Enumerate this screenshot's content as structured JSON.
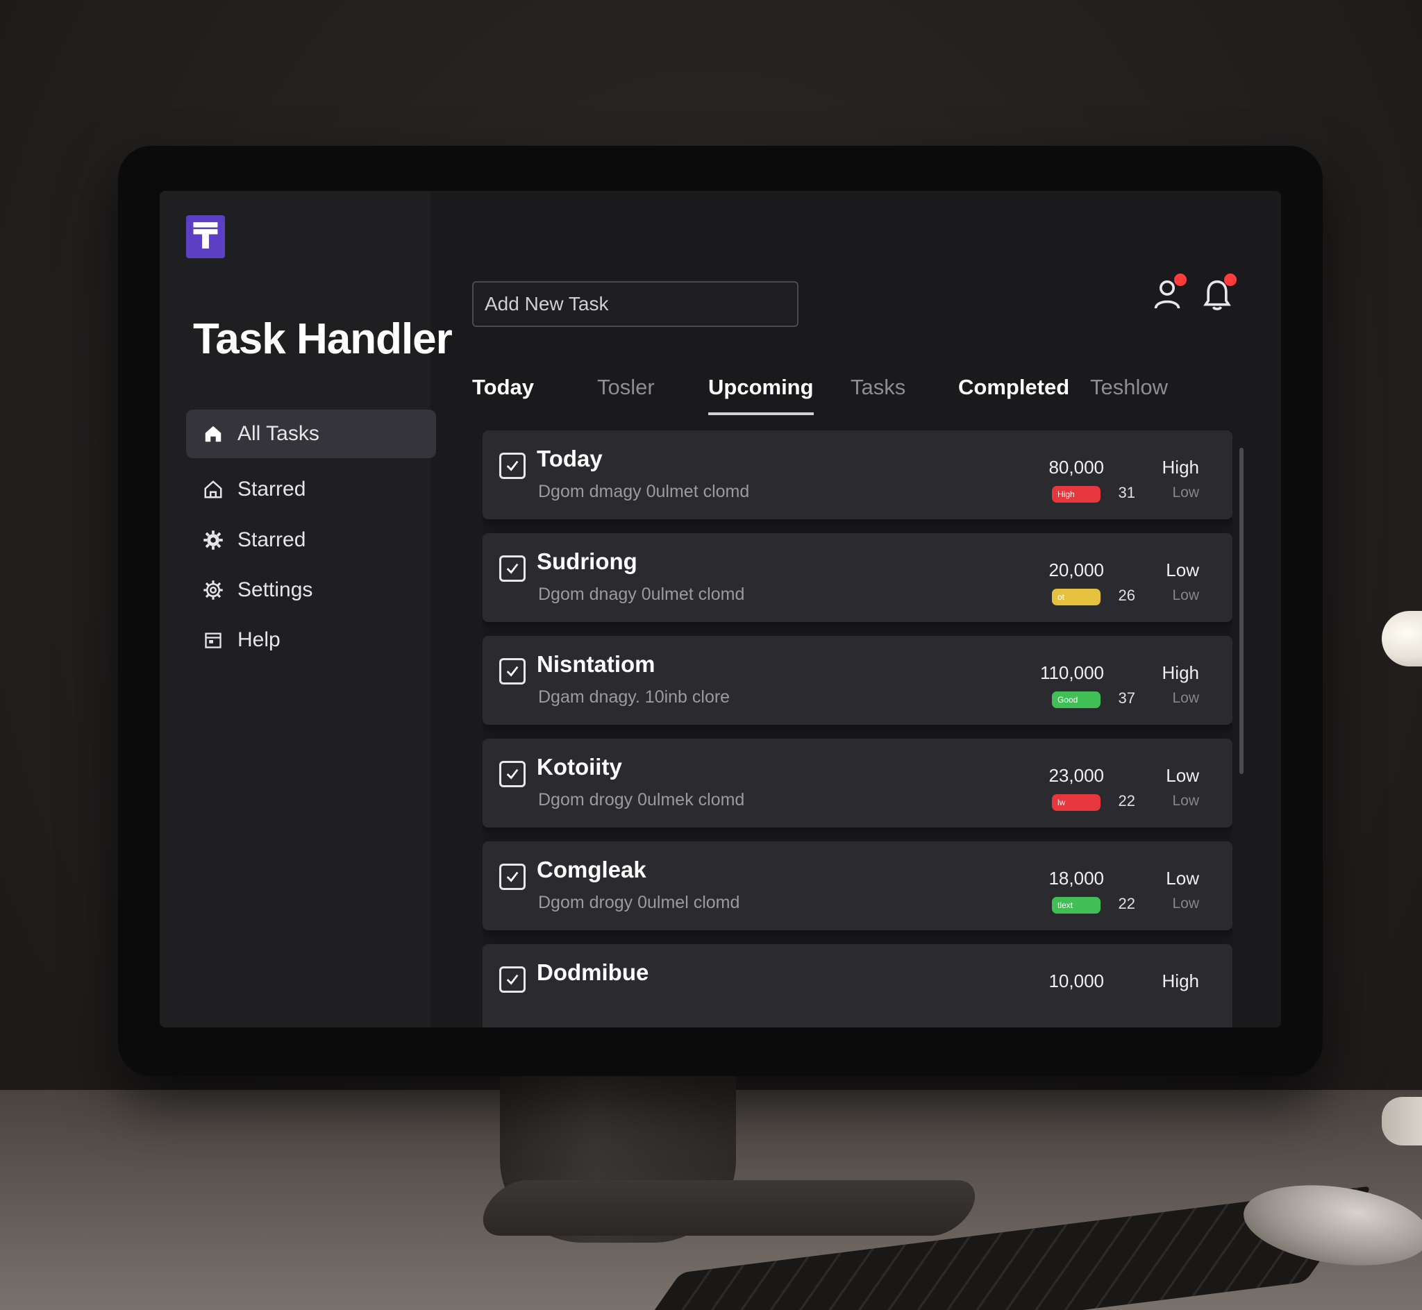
{
  "app": {
    "title": "Task Handler",
    "logo_glyph": "₸"
  },
  "sidebar": {
    "items": [
      {
        "label": "All Tasks",
        "icon": "home-icon",
        "active": true
      },
      {
        "label": "Starred",
        "icon": "house-outline-icon",
        "active": false
      },
      {
        "label": "Starred",
        "icon": "gear-icon",
        "active": false
      },
      {
        "label": "Settings",
        "icon": "cog-icon",
        "active": false
      },
      {
        "label": "Help",
        "icon": "calendar-icon",
        "active": false
      }
    ]
  },
  "header": {
    "add_task_placeholder": "Add New Task",
    "icons": [
      "user-notification-icon",
      "bell-icon"
    ]
  },
  "tabs": [
    {
      "label": "Today"
    },
    {
      "label": "Tosler"
    },
    {
      "label": "Upcoming"
    },
    {
      "label": "Tasks"
    },
    {
      "label": "Completed"
    },
    {
      "label": "Teshlow"
    }
  ],
  "tasks": [
    {
      "title": "Today",
      "description": "Dgom dmagy 0ulmet clomd",
      "amount": "80,000",
      "priority": "High",
      "pill_label": "High",
      "pill_color": "#e5373d",
      "count": "31",
      "sub": "Low"
    },
    {
      "title": "Sudriong",
      "description": "Dgom dnagy 0ulmet clomd",
      "amount": "20,000",
      "priority": "Low",
      "pill_label": "ot",
      "pill_color": "#e6c13f",
      "count": "26",
      "sub": "Low"
    },
    {
      "title": "Nisntatiom",
      "description": "Dgam dnagy. 10inb clore",
      "amount": "110,000",
      "priority": "High",
      "pill_label": "Good",
      "pill_color": "#3fbf55",
      "count": "37",
      "sub": "Low"
    },
    {
      "title": "Kotoiity",
      "description": "Dgom drogy 0ulmek clomd",
      "amount": "23,000",
      "priority": "Low",
      "pill_label": "lw",
      "pill_color": "#e5373d",
      "count": "22",
      "sub": "Low"
    },
    {
      "title": "Comgleak",
      "description": "Dgom drogy 0ulmel clomd",
      "amount": "18,000",
      "priority": "Low",
      "pill_label": "tlext",
      "pill_color": "#3fbf55",
      "count": "22",
      "sub": "Low"
    },
    {
      "title": "Dodmibue",
      "description": "",
      "amount": "10,000",
      "priority": "High",
      "pill_label": "",
      "pill_color": "#3fbf55",
      "count": "",
      "sub": ""
    }
  ]
}
